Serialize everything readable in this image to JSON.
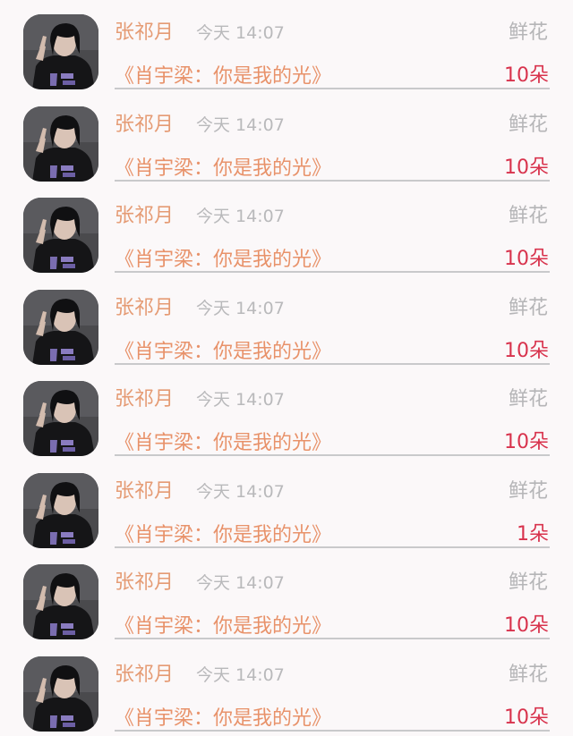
{
  "entries": [
    {
      "user": "张祁月",
      "time": "今天 14:07",
      "gift_type": "鲜花",
      "work": "《肖宇梁：你是我的光》",
      "count": "10朵"
    },
    {
      "user": "张祁月",
      "time": "今天 14:07",
      "gift_type": "鲜花",
      "work": "《肖宇梁：你是我的光》",
      "count": "10朵"
    },
    {
      "user": "张祁月",
      "time": "今天 14:07",
      "gift_type": "鲜花",
      "work": "《肖宇梁：你是我的光》",
      "count": "10朵"
    },
    {
      "user": "张祁月",
      "time": "今天 14:07",
      "gift_type": "鲜花",
      "work": "《肖宇梁：你是我的光》",
      "count": "10朵"
    },
    {
      "user": "张祁月",
      "time": "今天 14:07",
      "gift_type": "鲜花",
      "work": "《肖宇梁：你是我的光》",
      "count": "10朵"
    },
    {
      "user": "张祁月",
      "time": "今天 14:07",
      "gift_type": "鲜花",
      "work": "《肖宇梁：你是我的光》",
      "count": "1朵"
    },
    {
      "user": "张祁月",
      "time": "今天 14:07",
      "gift_type": "鲜花",
      "work": "《肖宇梁：你是我的光》",
      "count": "10朵"
    },
    {
      "user": "张祁月",
      "time": "今天 14:07",
      "gift_type": "鲜花",
      "work": "《肖宇梁：你是我的光》",
      "count": "10朵"
    }
  ],
  "colors": {
    "background": "#fbf8f9",
    "name": "#e59b74",
    "time": "#b9b9bb",
    "gift_type": "#b5b5b7",
    "work_title": "#e8926a",
    "count": "#d8334d",
    "divider": "#c9c9cb"
  }
}
